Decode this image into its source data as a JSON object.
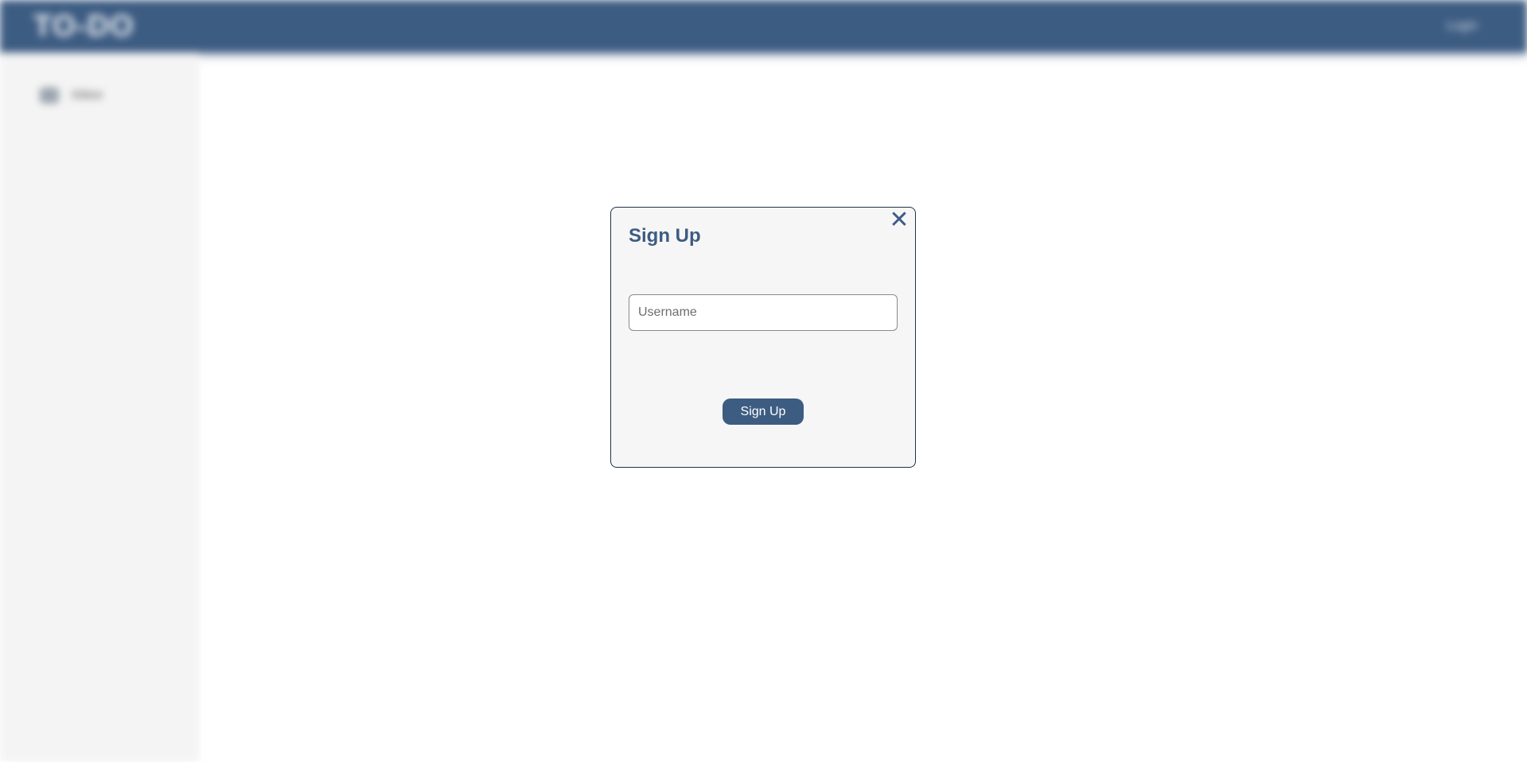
{
  "app": {
    "brand": "TO-DO",
    "login_label": "Login"
  },
  "sidebar": {
    "items": [
      {
        "label": "Inbox",
        "icon": "inbox-icon"
      }
    ]
  },
  "modal": {
    "title": "Sign Up",
    "close_label": "✕",
    "username_placeholder": "Username",
    "username_value": "",
    "submit_label": "Sign Up"
  },
  "colors": {
    "primary": "#3d5c82",
    "modal_background": "#f6f6f6",
    "modal_border": "#23314a",
    "sidebar_background": "#f4f4f4"
  }
}
